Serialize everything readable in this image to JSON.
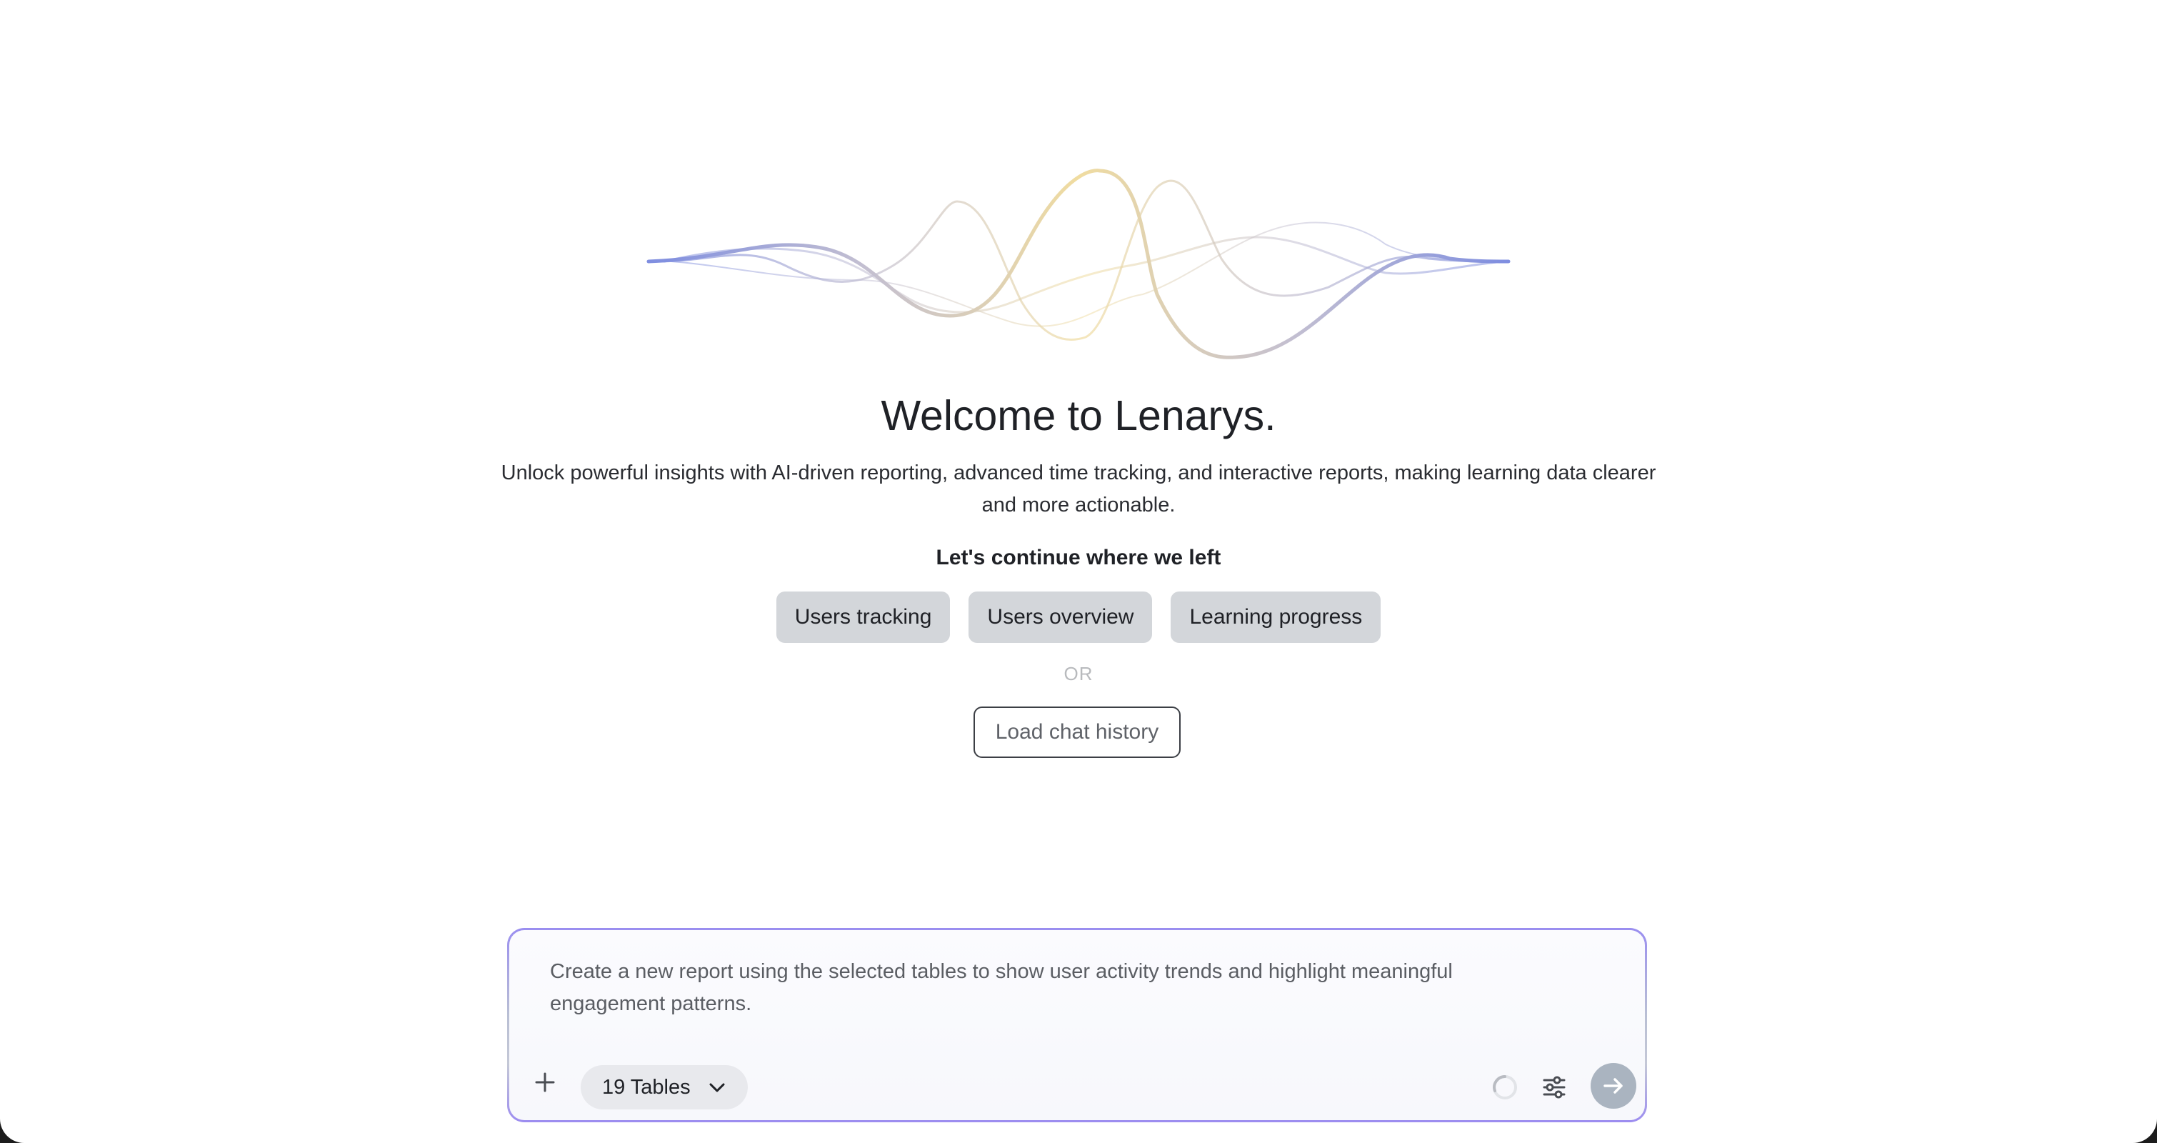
{
  "welcome": {
    "title": "Welcome to Lenarys.",
    "subtitle": "Unlock powerful insights with AI-driven reporting, advanced time tracking, and interactive reports, making learning data clearer and more actionable."
  },
  "continue_section": {
    "heading": "Let's continue where we left",
    "chips": [
      {
        "label": "Users tracking"
      },
      {
        "label": "Users overview"
      },
      {
        "label": "Learning progress"
      }
    ],
    "separator": "OR",
    "history_button": "Load chat history"
  },
  "composer": {
    "text": "Create a new report using the selected tables to show user activity trends and highlight meaningful engagement patterns.",
    "tables_selector": "19 Tables",
    "icons": {
      "add": "plus-icon",
      "dropdown": "chevron-down-icon",
      "status": "spinner-icon",
      "settings": "sliders-icon",
      "send": "arrow-right-icon"
    }
  },
  "colors": {
    "wave_blue": "#7f8ee0",
    "wave_gold": "#f0dca0",
    "chip_bg": "#d3d6da",
    "send_button": "#aab4c0"
  }
}
